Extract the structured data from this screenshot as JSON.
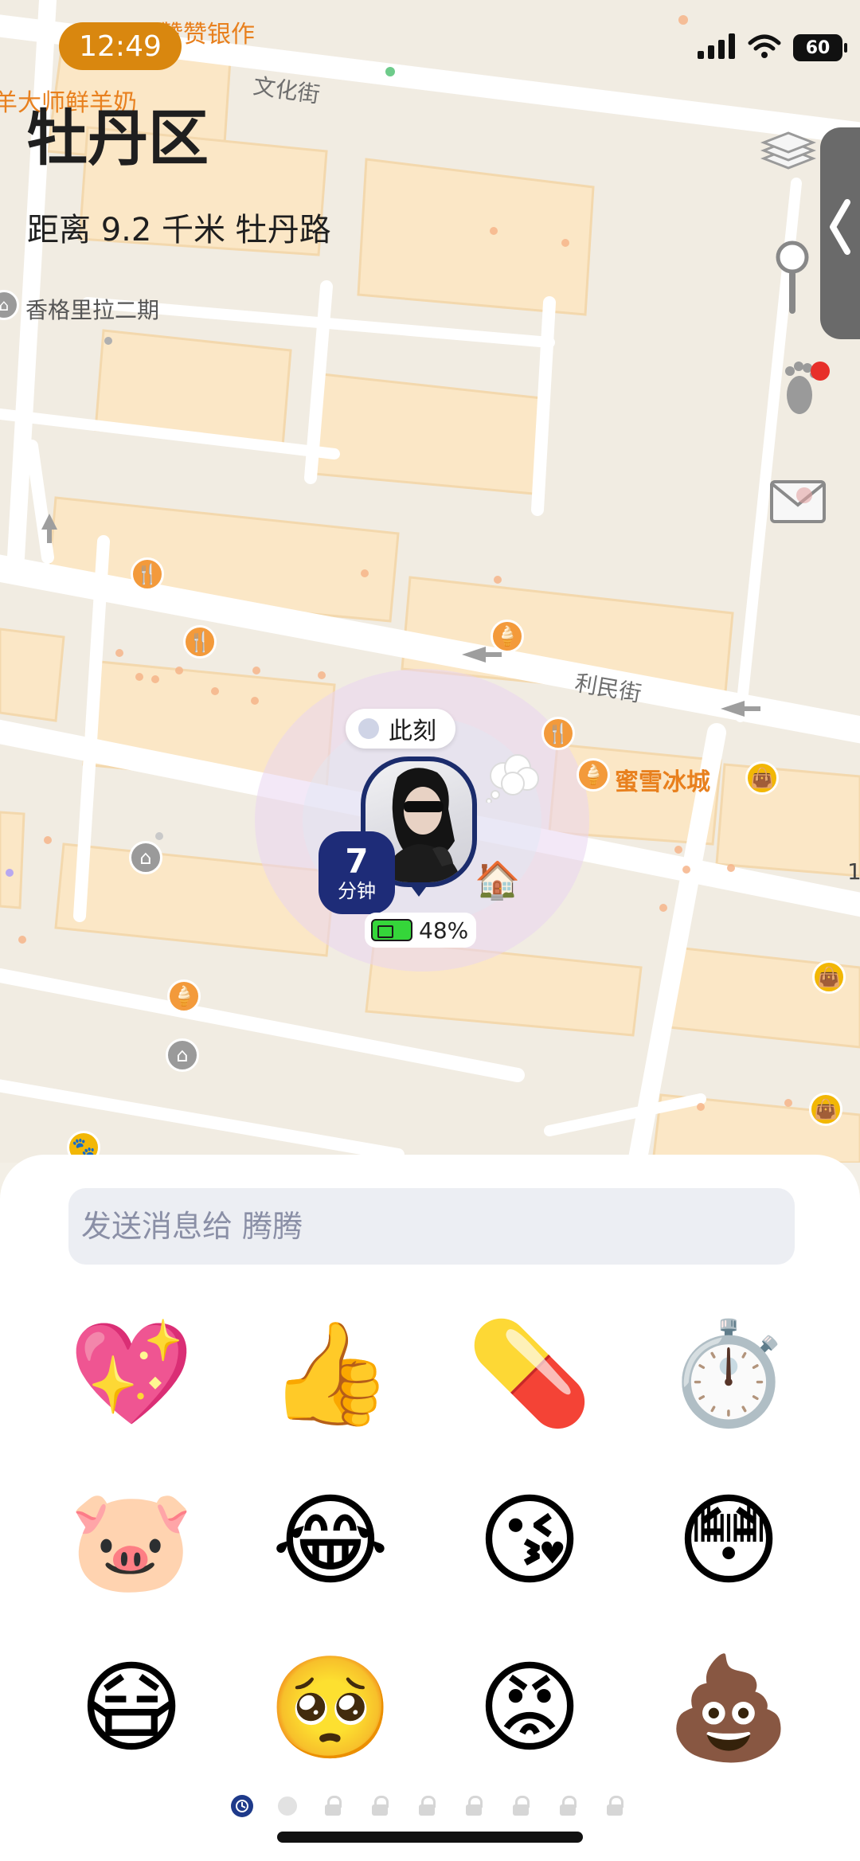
{
  "status_bar": {
    "time": "12:49",
    "battery_level": "60",
    "signal_icon": "cellular-signal-icon",
    "wifi_icon": "wifi-icon"
  },
  "header": {
    "district": "牡丹区",
    "distance_text": "距离 9.2 千米 牡丹路"
  },
  "map": {
    "street_labels": [
      {
        "id": "wenhua",
        "text": "文化街"
      },
      {
        "id": "limin",
        "text": "利民街"
      }
    ],
    "place_labels": [
      {
        "id": "zanzan",
        "text": "赞赞银作"
      },
      {
        "id": "yang",
        "text": "羊大师鲜羊奶"
      },
      {
        "id": "xiangge",
        "text": "香格里拉二期"
      },
      {
        "id": "mixue",
        "text": "蜜雪冰城"
      },
      {
        "id": "edge",
        "text": "1"
      }
    ],
    "colors": {
      "background": "#f1ece2",
      "block": "#fbe7c6",
      "road": "#ffffff",
      "poi_orange": "#f39a3b",
      "poi_yellow": "#f2b705"
    }
  },
  "tools": {
    "layers_icon": "layers-icon",
    "pin_icon": "location-pin-icon",
    "footprint_icon": "footprint-icon",
    "mail_icon": "mail-icon",
    "collapse_icon": "chevron-left-icon"
  },
  "friend": {
    "status_bubble": "此刻",
    "minutes_value": "7",
    "minutes_unit": "分钟",
    "battery_percent": "48%",
    "accent": "#1e2c78"
  },
  "message": {
    "placeholder": "发送消息给 腾腾"
  },
  "emojis": [
    {
      "char": "💖",
      "name": "sparkling-heart-emoji"
    },
    {
      "char": "👍",
      "name": "thumbs-up-emoji"
    },
    {
      "char": "💊",
      "name": "pill-emoji"
    },
    {
      "char": "⏱️",
      "name": "stopwatch-emoji"
    },
    {
      "char": "🐷",
      "name": "pig-face-emoji"
    },
    {
      "char": "😂",
      "name": "tears-of-joy-emoji"
    },
    {
      "char": "😘",
      "name": "blowing-kiss-emoji"
    },
    {
      "char": "😳",
      "name": "flushed-face-emoji"
    },
    {
      "char": "😷",
      "name": "face-with-mask-emoji"
    },
    {
      "char": "🥺",
      "name": "pleading-face-emoji"
    },
    {
      "char": "😡",
      "name": "pouting-face-emoji"
    },
    {
      "char": "💩",
      "name": "pile-of-poo-emoji"
    }
  ],
  "pager": {
    "pages": 9,
    "active_index": 0,
    "locked_from": 2
  }
}
